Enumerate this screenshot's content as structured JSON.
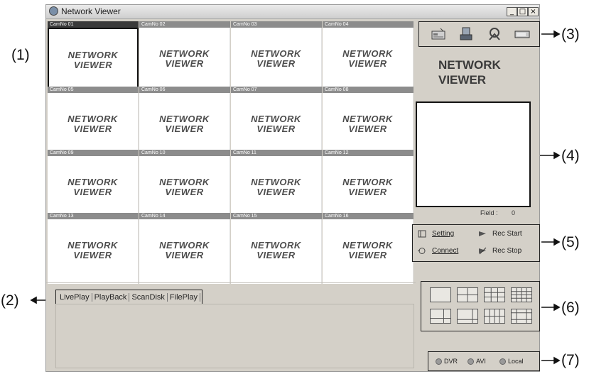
{
  "window": {
    "title": "Network Viewer",
    "controls": [
      "_",
      "□",
      "×"
    ]
  },
  "cameras": [
    "CamNo 01",
    "CamNo 02",
    "CamNo 03",
    "CamNo 04",
    "CamNo 05",
    "CamNo 06",
    "CamNo 07",
    "CamNo 08",
    "CamNo 09",
    "CamNo 10",
    "CamNo 11",
    "CamNo 12",
    "CamNo 13",
    "CamNo 14",
    "CamNo 15",
    "CamNo 16"
  ],
  "selected_camera": "CamNo 01",
  "logo": {
    "line1": "NETWORK",
    "line2": "VIEWER"
  },
  "toolbar": {
    "icons": [
      "dvr-icon",
      "user-icon",
      "tools-icon",
      "display-icon"
    ]
  },
  "brand": {
    "line1": "NETWORK",
    "line2": "VIEWER"
  },
  "field": {
    "label": "Field :",
    "value": "0"
  },
  "controls": {
    "setting": "Setting",
    "connect": "Connect",
    "rec_start": "Rec Start",
    "rec_stop": "Rec Stop"
  },
  "layouts": [
    "1-split",
    "4-split",
    "9-split",
    "16-split",
    "6-split",
    "8-split",
    "10-split",
    "13-split"
  ],
  "sources": {
    "dvr": "DVR",
    "avi": "AVI",
    "local": "Local"
  },
  "tabs": [
    "LivePlay",
    "PlayBack",
    "ScanDisk",
    "FilePlay"
  ],
  "callouts": {
    "c1": "(1)",
    "c2": "(2)",
    "c3": "(3)",
    "c4": "(4)",
    "c5": "(5)",
    "c6": "(6)",
    "c7": "(7)"
  }
}
